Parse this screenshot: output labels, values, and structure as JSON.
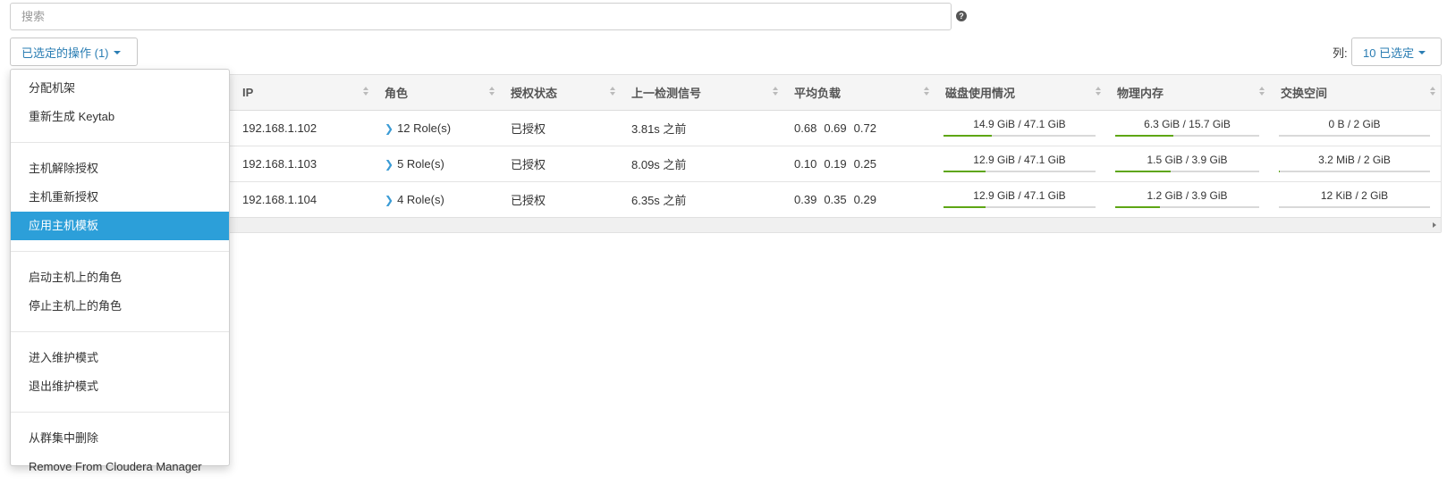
{
  "search": {
    "placeholder": "搜索"
  },
  "toolbar": {
    "actions_label": "已选定的操作 (1)",
    "columns_label": "列:",
    "columns_button": "10 已选定"
  },
  "table": {
    "headers": [
      "IP",
      "角色",
      "授权状态",
      "上一检测信号",
      "平均负载",
      "磁盘使用情况",
      "物理内存",
      "交换空间"
    ],
    "rows": [
      {
        "ip": "192.168.1.102",
        "roles": "12 Role(s)",
        "auth": "已授权",
        "heartbeat": "3.81s 之前",
        "load": [
          "0.68",
          "0.69",
          "0.72"
        ],
        "disk": "14.9 GiB / 47.1 GiB",
        "disk_pct": 31.6,
        "memory": "6.3 GiB / 15.7 GiB",
        "memory_pct": 40.1,
        "swap": "0 B / 2 GiB",
        "swap_pct": 0
      },
      {
        "ip": "192.168.1.103",
        "roles": "5 Role(s)",
        "auth": "已授权",
        "heartbeat": "8.09s 之前",
        "load": [
          "0.10",
          "0.19",
          "0.25"
        ],
        "disk": "12.9 GiB / 47.1 GiB",
        "disk_pct": 27.4,
        "memory": "1.5 GiB / 3.9 GiB",
        "memory_pct": 38.5,
        "swap": "3.2 MiB / 2 GiB",
        "swap_pct": 0.2
      },
      {
        "ip": "192.168.1.104",
        "roles": "4 Role(s)",
        "auth": "已授权",
        "heartbeat": "6.35s 之前",
        "load": [
          "0.39",
          "0.35",
          "0.29"
        ],
        "disk": "12.9 GiB / 47.1 GiB",
        "disk_pct": 27.4,
        "memory": "1.2 GiB / 3.9 GiB",
        "memory_pct": 30.8,
        "swap": "12 KiB / 2 GiB",
        "swap_pct": 0
      }
    ]
  },
  "menu": {
    "items": [
      "分配机架",
      "重新生成 Keytab",
      "主机解除授权",
      "主机重新授权",
      "应用主机模板",
      "启动主机上的角色",
      "停止主机上的角色",
      "进入维护模式",
      "退出维护模式",
      "从群集中删除",
      "Remove From Cloudera Manager"
    ]
  },
  "colors": {
    "accent": "#2a7db3",
    "menu_active": "#2c9fd9",
    "usage_bar": "#5ea614"
  },
  "icons": {
    "help": "question-circle-icon",
    "caret": "caret-down-icon",
    "role_expand": "chevron-right-icon"
  }
}
